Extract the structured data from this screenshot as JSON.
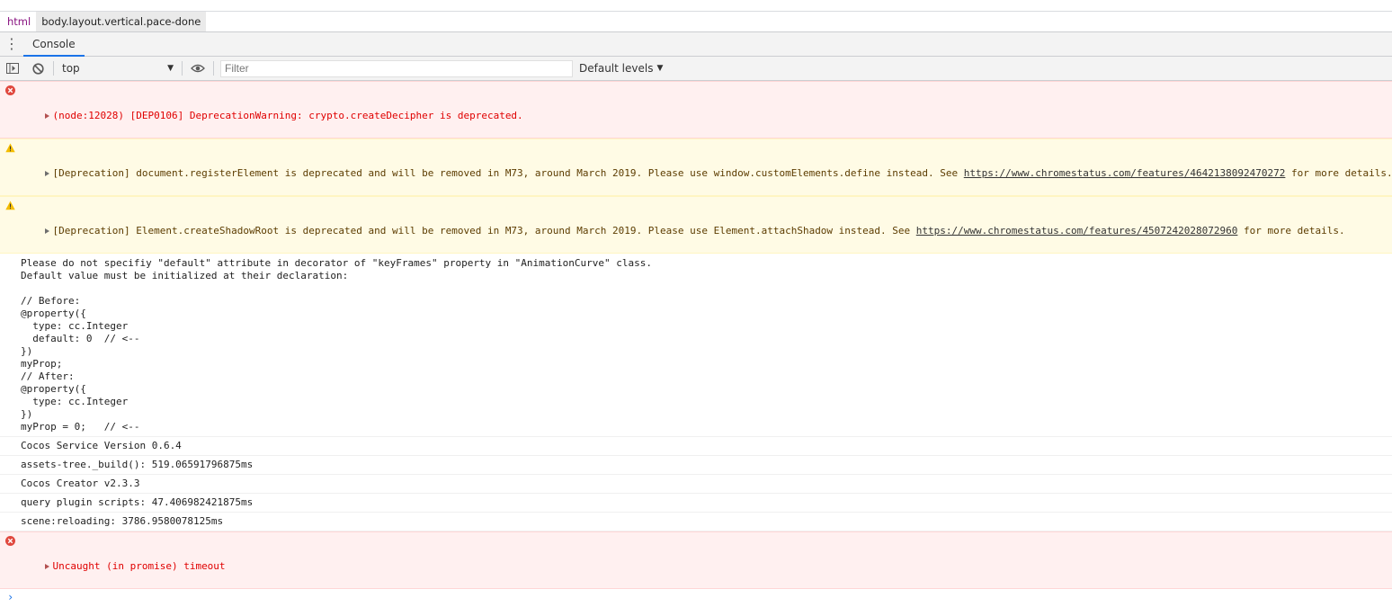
{
  "breadcrumb": {
    "tag": "html",
    "selected": "body.layout.vertical.pace-done"
  },
  "tabs": {
    "console": "Console"
  },
  "toolbar": {
    "context": "top",
    "filter_placeholder": "Filter",
    "levels": "Default levels"
  },
  "console": {
    "m1": "(node:12028) [DEP0106] DeprecationWarning: crypto.createDecipher is deprecated.",
    "m2": {
      "pre": "[Deprecation] document.registerElement is deprecated and will be removed in M73, around March 2019. Please use window.customElements.define instead. See ",
      "link": "https://www.chromestatus.com/features/4642138092470272",
      "post": " for more details."
    },
    "m3": {
      "pre": "[Deprecation] Element.createShadowRoot is deprecated and will be removed in M73, around March 2019. Please use Element.attachShadow instead. See ",
      "link": "https://www.chromestatus.com/features/4507242028072960",
      "post": " for more details."
    },
    "m4": "Please do not specifiy \"default\" attribute in decorator of \"keyFrames\" property in \"AnimationCurve\" class.\nDefault value must be initialized at their declaration:\n\n// Before:\n@property({\n  type: cc.Integer\n  default: 0  // <--\n})\nmyProp;\n// After:\n@property({\n  type: cc.Integer\n})\nmyProp = 0;   // <--",
    "m5": "Cocos Service Version 0.6.4",
    "m6": "assets-tree._build(): 519.06591796875ms",
    "m7": "Cocos Creator v2.3.3",
    "m8": "query plugin scripts: 47.406982421875ms",
    "m9": "scene:reloading: 3786.9580078125ms",
    "m10": "Uncaught (in promise) timeout"
  },
  "colors": {
    "error": "#e00000",
    "error_bg": "#fff0f0",
    "warning_bg": "#fffbe5",
    "accent": "#1a73e8"
  }
}
